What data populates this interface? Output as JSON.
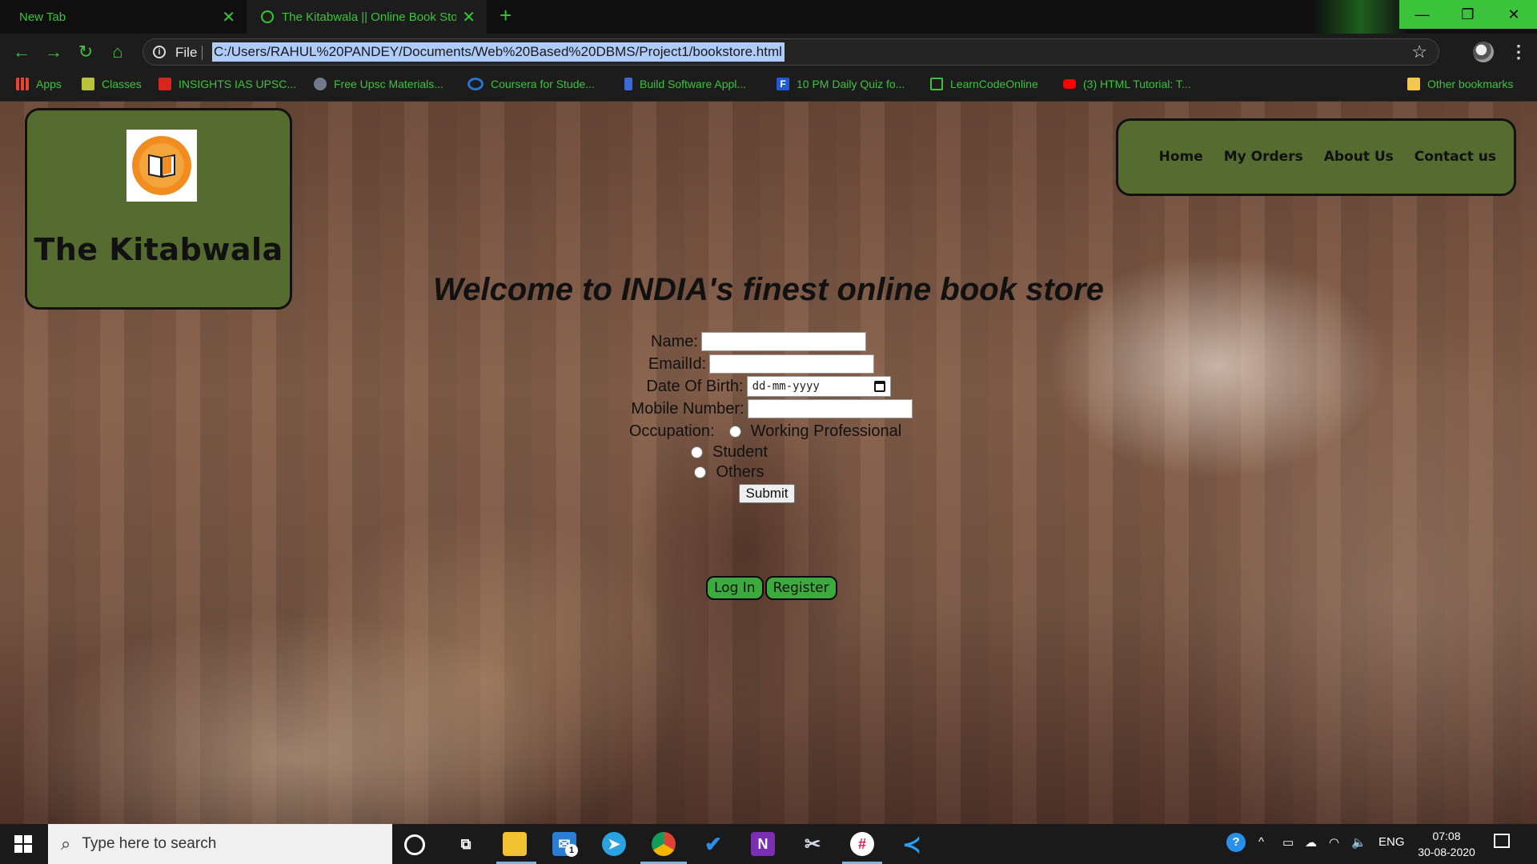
{
  "browser": {
    "tabs": [
      {
        "title": "New Tab"
      },
      {
        "title": "The Kitabwala || Online Book Store"
      }
    ],
    "omnibox": {
      "scheme_label": "File",
      "url": "C:/Users/RAHUL%20PANDEY/Documents/Web%20Based%20DBMS/Project1/bookstore.html"
    },
    "bookmarks": [
      {
        "label": "Apps",
        "icon": "apps-grid-icon",
        "color": "#e94335"
      },
      {
        "label": "Classes",
        "icon": "folder-icon",
        "color": "#b9c23a"
      },
      {
        "label": "INSIGHTS IAS UPSC...",
        "icon": "insights-icon",
        "color": "#d7261e"
      },
      {
        "label": "Free Upsc Materials...",
        "icon": "upsc-icon",
        "color": "#6f7a8a"
      },
      {
        "label": "Coursera for Stude...",
        "icon": "coursera-icon",
        "color": "#2a73cc"
      },
      {
        "label": "Build Software Appl...",
        "icon": "figure-icon",
        "color": "#3a6ad8"
      },
      {
        "label": "10 PM Daily Quiz fo...",
        "icon": "f-icon",
        "color": "#1f5bd6"
      },
      {
        "label": "LearnCodeOnline",
        "icon": "code-icon",
        "color": "#3cc33c"
      },
      {
        "label": "(3) HTML Tutorial: T...",
        "icon": "youtube-icon",
        "color": "#ff0000"
      }
    ],
    "other_bookmarks": "Other bookmarks"
  },
  "page": {
    "brand": {
      "name": "The Kitabwala"
    },
    "nav": [
      "Home",
      "My Orders",
      "About Us",
      "Contact us"
    ],
    "welcome": "Welcome to INDIA's finest online book store",
    "form": {
      "name_label": "Name:",
      "email_label": "EmailId:",
      "dob_label": "Date Of Birth:",
      "dob_placeholder": "dd-mm-yyyy",
      "mobile_label": "Mobile Number:",
      "occupation_label": "Occupation:",
      "occupation_options": [
        "Working Professional",
        "Student",
        "Others"
      ],
      "submit": "Submit"
    },
    "auth": {
      "login": "Log In",
      "register": "Register"
    }
  },
  "taskbar": {
    "search_placeholder": "Type here to search",
    "language": "ENG",
    "time": "07:08",
    "date": "30-08-2020",
    "mail_badge": "1"
  },
  "colors": {
    "card_green": "#556b2f",
    "chrome_accent": "#3cc33c",
    "button_green": "#3daa3d"
  }
}
